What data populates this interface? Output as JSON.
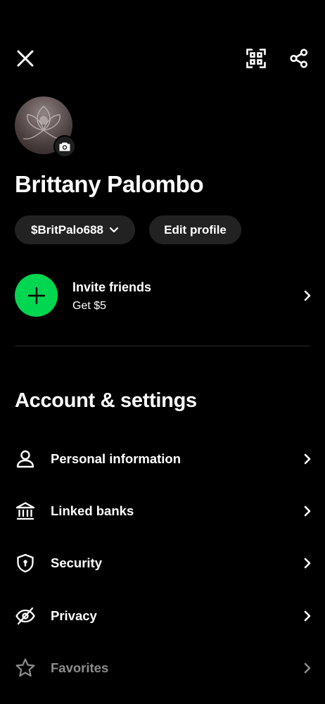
{
  "top_bar": {
    "close_icon": "close-icon",
    "qr_icon": "qr-scan-icon",
    "share_icon": "share-icon"
  },
  "profile": {
    "avatar_icon": "avatar",
    "camera_icon": "camera-icon",
    "name": "Brittany Palombo",
    "cashtag": "$BritPalo688",
    "edit_label": "Edit profile"
  },
  "invite": {
    "title": "Invite friends",
    "subtitle": "Get $5",
    "accent_color": "#00d64f"
  },
  "settings": {
    "title": "Account & settings",
    "items": [
      {
        "label": "Personal information",
        "icon": "person-icon"
      },
      {
        "label": "Linked banks",
        "icon": "bank-icon"
      },
      {
        "label": "Security",
        "icon": "shield-icon"
      },
      {
        "label": "Privacy",
        "icon": "eye-off-icon"
      },
      {
        "label": "Favorites",
        "icon": "star-icon"
      }
    ]
  }
}
